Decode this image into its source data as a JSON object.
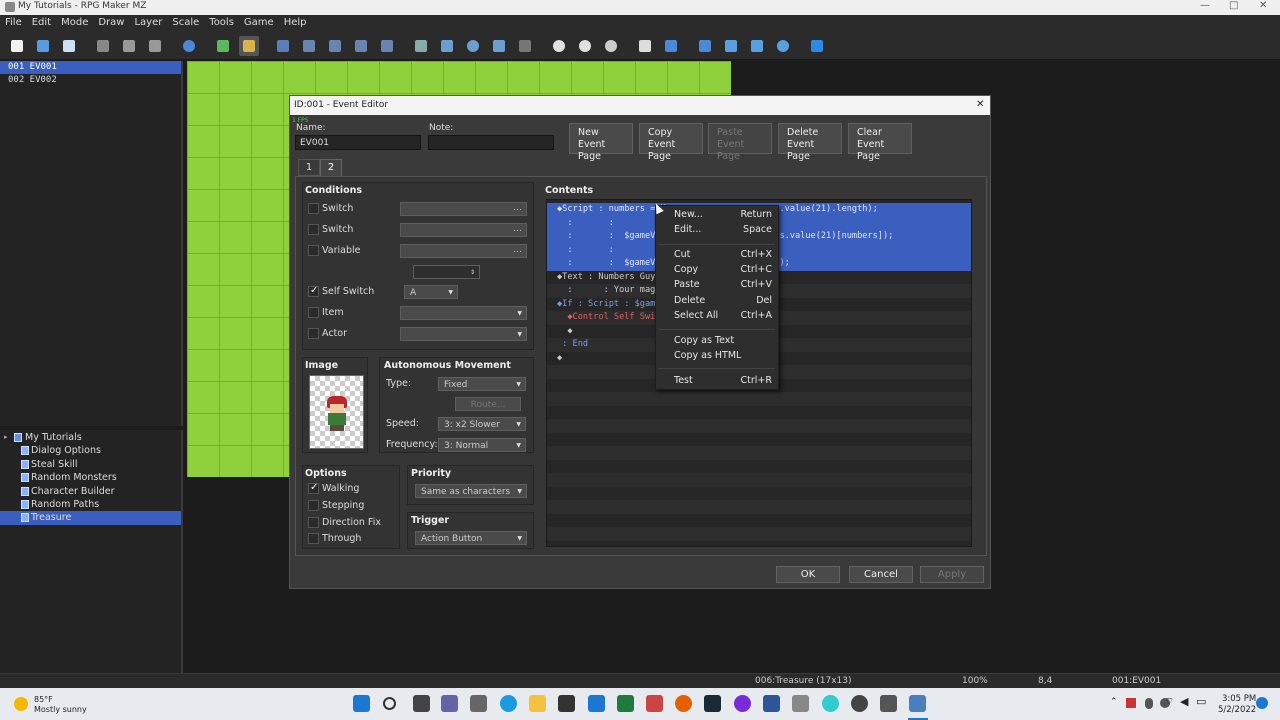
{
  "window": {
    "title": "My Tutorials - RPG Maker MZ",
    "minimize": "—",
    "maximize": "□",
    "close": "✕"
  },
  "menu": [
    "File",
    "Edit",
    "Mode",
    "Draw",
    "Layer",
    "Scale",
    "Tools",
    "Game",
    "Help"
  ],
  "events": [
    "001 EV001",
    "002 EV002"
  ],
  "maps": {
    "root": "My Tutorials",
    "items": [
      "Dialog Options",
      "Steal Skill",
      "Random Monsters",
      "Character Builder",
      "Random Paths",
      "Treasure"
    ]
  },
  "dialog": {
    "title": "ID:001 - Event Editor",
    "close": "✕",
    "fps": "1 FPS",
    "name_label": "Name:",
    "name_value": "EV001",
    "note_label": "Note:",
    "note_value": "",
    "page_buttons": [
      {
        "l1": "New",
        "l2": "Event Page"
      },
      {
        "l1": "Copy",
        "l2": "Event Page"
      },
      {
        "l1": "Paste",
        "l2": "Event Page"
      },
      {
        "l1": "Delete",
        "l2": "Event Page"
      },
      {
        "l1": "Clear",
        "l2": "Event Page"
      }
    ],
    "tabs": [
      "1",
      "2"
    ],
    "conditions": {
      "title": "Conditions",
      "switch1": "Switch",
      "switch2": "Switch",
      "variable": "Variable",
      "self_switch": "Self Switch",
      "self_switch_value": "A",
      "item": "Item",
      "actor": "Actor"
    },
    "image": {
      "title": "Image"
    },
    "autonomous": {
      "title": "Autonomous Movement",
      "type_label": "Type:",
      "type_value": "Fixed",
      "route": "Route...",
      "speed_label": "Speed:",
      "speed_value": "3: x2 Slower",
      "freq_label": "Frequency:",
      "freq_value": "3: Normal"
    },
    "options": {
      "title": "Options",
      "walking": "Walking",
      "stepping": "Stepping",
      "direction_fix": "Direction Fix",
      "through": "Through"
    },
    "priority": {
      "title": "Priority",
      "value": "Same as characters"
    },
    "trigger": {
      "title": "Trigger",
      "value": "Action Button"
    },
    "contents": {
      "title": "Contents",
      "lines": [
        "◆Script : numbers = M                     s.value(21).length);",
        "  :       :",
        "  :       :  $gameVariab               ables.value(21)[numbers]);",
        "  :       :",
        "  :       :  $gameVariab               s, 1);",
        "◆Text : Numbers Guy, A",
        "  :      : Your magic nu",
        "◆If : Script : $gameVa",
        "  ◆Control Self Switc",
        "  ◆",
        " : End",
        "◆"
      ]
    },
    "ok": "OK",
    "cancel": "Cancel",
    "apply": "Apply"
  },
  "context_menu": [
    {
      "label": "New...",
      "key": "Return"
    },
    {
      "label": "Edit...",
      "key": "Space"
    },
    {
      "label": "Cut",
      "key": "Ctrl+X"
    },
    {
      "label": "Copy",
      "key": "Ctrl+C"
    },
    {
      "label": "Paste",
      "key": "Ctrl+V"
    },
    {
      "label": "Delete",
      "key": "Del"
    },
    {
      "label": "Select All",
      "key": "Ctrl+A"
    },
    {
      "label": "Copy as Text",
      "key": ""
    },
    {
      "label": "Copy as HTML",
      "key": ""
    },
    {
      "label": "Test",
      "key": "Ctrl+R"
    }
  ],
  "status": {
    "map": "006:Treasure (17x13)",
    "zoom": "100%",
    "coords": "8,4",
    "event": "001:EV001"
  },
  "taskbar": {
    "temp": "85°F",
    "weather": "Mostly sunny",
    "time": "3:05 PM",
    "date": "5/2/2022"
  }
}
